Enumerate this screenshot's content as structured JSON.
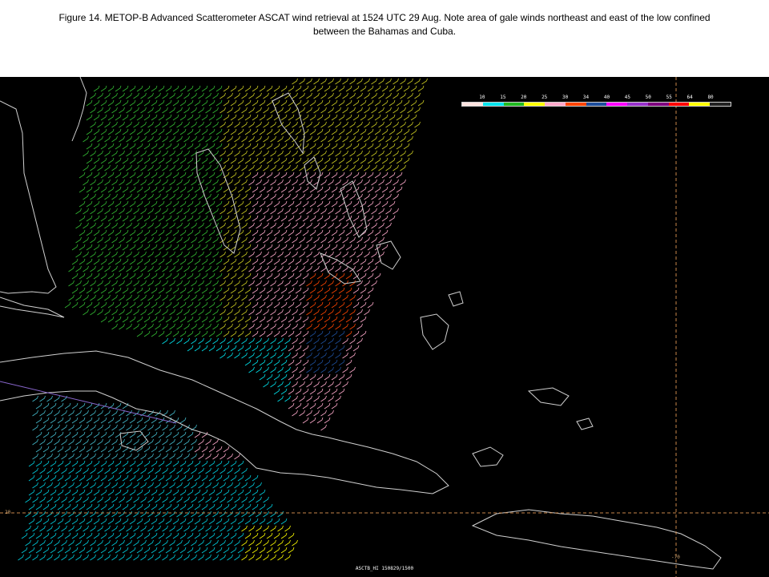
{
  "caption": {
    "line1": "Figure 14. METOP-B Advanced Scatterometer ASCAT wind retrieval at 1524 UTC 29 Aug.  Note area of gale winds northeast and east of the low confined",
    "line2": "between the Bahamas and Cuba."
  },
  "legend": {
    "labels": [
      "10",
      "15",
      "20",
      "25",
      "30",
      "34",
      "40",
      "45",
      "50",
      "55",
      "64",
      "80",
      ""
    ],
    "colors": [
      "#ffe4e1",
      "#00e5ee",
      "#22bb22",
      "#ffff00",
      "#ffaacc",
      "#ff4500",
      "#1e4f9c",
      "#ff00ff",
      "#9932cc",
      "#800080",
      "#ff0000",
      "#ffff00",
      "#222222"
    ]
  },
  "map": {
    "lat_label": "20",
    "lon_label": "-70",
    "footer": "ASCTB_HI  150829/1500",
    "land_outline_color": "#d0d0d0",
    "grid_color": "#c8864a"
  }
}
